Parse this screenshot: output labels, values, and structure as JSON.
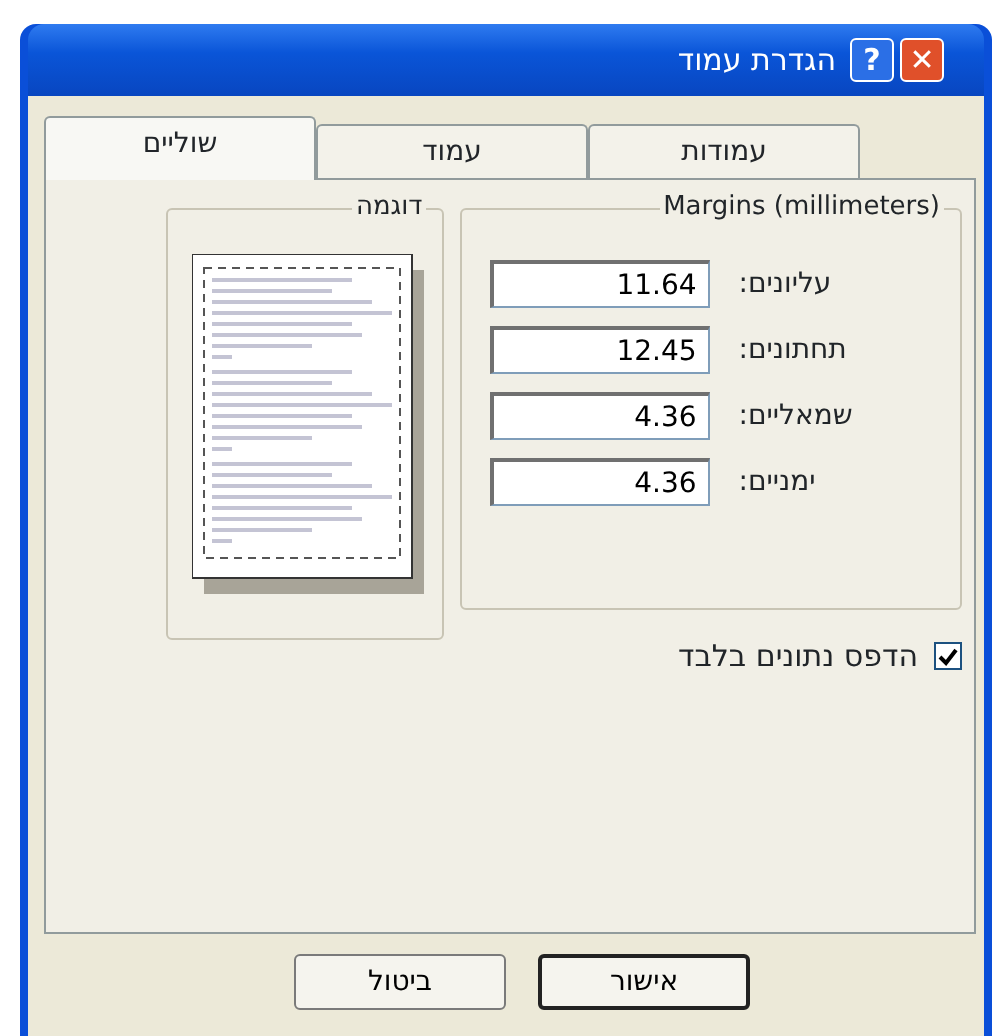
{
  "window": {
    "title": "הגדרת עמוד",
    "help_button": "?",
    "close_button": "✕"
  },
  "tabs": [
    {
      "label": "עמודות",
      "selected": false
    },
    {
      "label": "עמוד",
      "selected": false
    },
    {
      "label": "שוליים",
      "selected": true
    }
  ],
  "margins_group": {
    "title": "Margins (millimeters)",
    "fields": [
      {
        "label": "עליונים:",
        "value": "11.64"
      },
      {
        "label": "תחתונים:",
        "value": "12.45"
      },
      {
        "label": "שמאליים:",
        "value": "4.36"
      },
      {
        "label": "ימניים:",
        "value": "4.36"
      }
    ]
  },
  "preview_group": {
    "title": "דוגמה"
  },
  "data_only": {
    "label": "הדפס נתונים בלבד",
    "checked": true
  },
  "buttons": [
    {
      "label": "אישור",
      "default": true
    },
    {
      "label": "ביטול",
      "default": false
    }
  ]
}
